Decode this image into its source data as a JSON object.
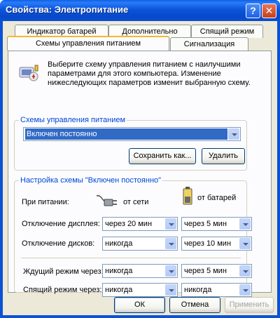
{
  "window": {
    "title": "Свойства: Электропитание",
    "help_label": "?",
    "close_label": "✕"
  },
  "tabs": {
    "battery_meter": "Индикатор батарей",
    "advanced": "Дополнительно",
    "hibernate": "Спящий режим",
    "power_schemes": "Схемы управления питанием",
    "alarms": "Сигнализация"
  },
  "intro": {
    "text": "Выберите схему управления питанием с наилучшими параметрами для этого компьютера. Изменение нижеследующих параметров изменит выбранную схему."
  },
  "schemes_group": {
    "legend": "Схемы управления питанием",
    "selected": "Включен постоянно",
    "save_as_label": "Сохранить как...",
    "delete_label": "Удалить"
  },
  "settings_group": {
    "legend": "Настройка схемы \"Включен постоянно\"",
    "power_label": "При питании:",
    "ac_label": "от сети",
    "battery_label": "от батарей",
    "rows": [
      {
        "label": "Отключение дисплея:",
        "ac": "через 20 мин",
        "dc": "через 5 мин"
      },
      {
        "label": "Отключение дисков:",
        "ac": "никогда",
        "dc": "через 10 мин"
      },
      {
        "label": "Ждущий режим через:",
        "ac": "никогда",
        "dc": "через 5 мин"
      },
      {
        "label": "Спящий режим через:",
        "ac": "никогда",
        "dc": "никогда"
      }
    ]
  },
  "footer": {
    "ok_label": "ОК",
    "cancel_label": "Отмена",
    "apply_label": "Применить"
  },
  "colors": {
    "titlebar": "#0a52d6",
    "dialog_bg": "#ece9d8",
    "group_legend": "#0046d5",
    "selection": "#316ac5"
  }
}
